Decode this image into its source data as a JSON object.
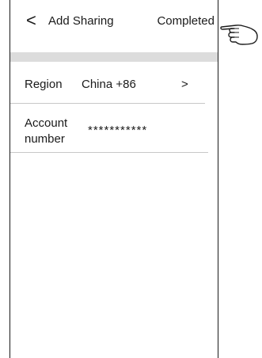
{
  "header": {
    "back_label": "<",
    "title": "Add Sharing",
    "completed_label": "Completed"
  },
  "form": {
    "region_label": "Region",
    "region_value": "China +86",
    "region_chevron": ">",
    "account_label": "Account number",
    "account_value": "***********"
  },
  "icons": {
    "pointer": "pointing-hand-icon"
  },
  "colors": {
    "separator_bar": "#dcdcdc",
    "divider": "#c8c8c8",
    "text": "#1a1a1a"
  }
}
